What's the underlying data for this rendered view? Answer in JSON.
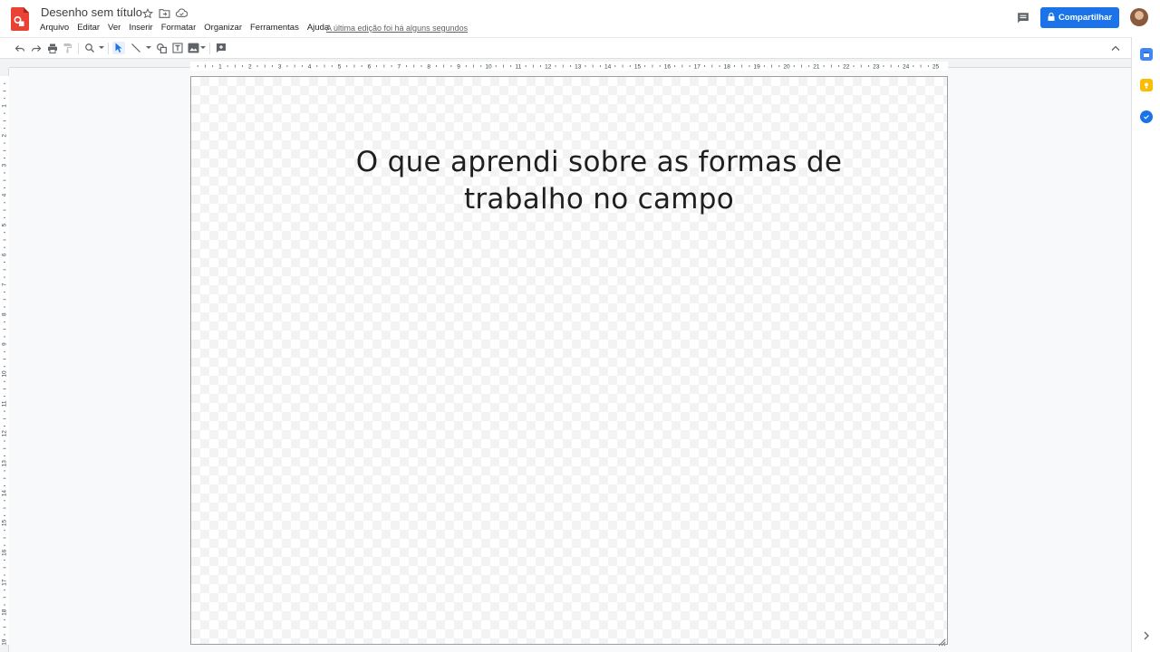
{
  "header": {
    "doc_title": "Desenho sem título",
    "last_edit": "A última edição foi há alguns segundos",
    "share_label": "Compartilhar"
  },
  "menu": [
    "Arquivo",
    "Editar",
    "Ver",
    "Inserir",
    "Formatar",
    "Organizar",
    "Ferramentas",
    "Ajuda"
  ],
  "rulers": {
    "horizontal": [
      "1",
      "2",
      "3",
      "4",
      "5",
      "6",
      "7",
      "8",
      "9",
      "10",
      "11",
      "12",
      "13",
      "14",
      "15",
      "16",
      "17",
      "18",
      "19",
      "20",
      "21",
      "22",
      "23",
      "24",
      "25"
    ],
    "vertical": [
      "1",
      "2",
      "3",
      "4",
      "5",
      "6",
      "7",
      "8",
      "9",
      "10",
      "11",
      "12",
      "13",
      "14",
      "15",
      "16",
      "17",
      "18",
      "19"
    ]
  },
  "canvas": {
    "text_line1": "O que aprendi sobre as formas de",
    "text_line2": "trabalho no campo"
  },
  "colors": {
    "accent": "#1a73e8",
    "app_icon": "#ea4335",
    "calendar_icon": "#4285f4",
    "keep_icon": "#fbbc04",
    "tasks_icon": "#1a73e8"
  },
  "icons": [
    "drawings-app-icon",
    "star-icon",
    "move-to-folder-icon",
    "cloud-saved-icon",
    "comment-icon",
    "lock-icon",
    "undo-icon",
    "redo-icon",
    "print-icon",
    "paint-format-icon",
    "zoom-icon",
    "select-icon",
    "line-icon",
    "shape-icon",
    "textbox-icon",
    "image-icon",
    "add-comment-icon",
    "collapse-icon",
    "calendar-icon",
    "keep-icon",
    "tasks-icon",
    "expand-panel-icon"
  ]
}
